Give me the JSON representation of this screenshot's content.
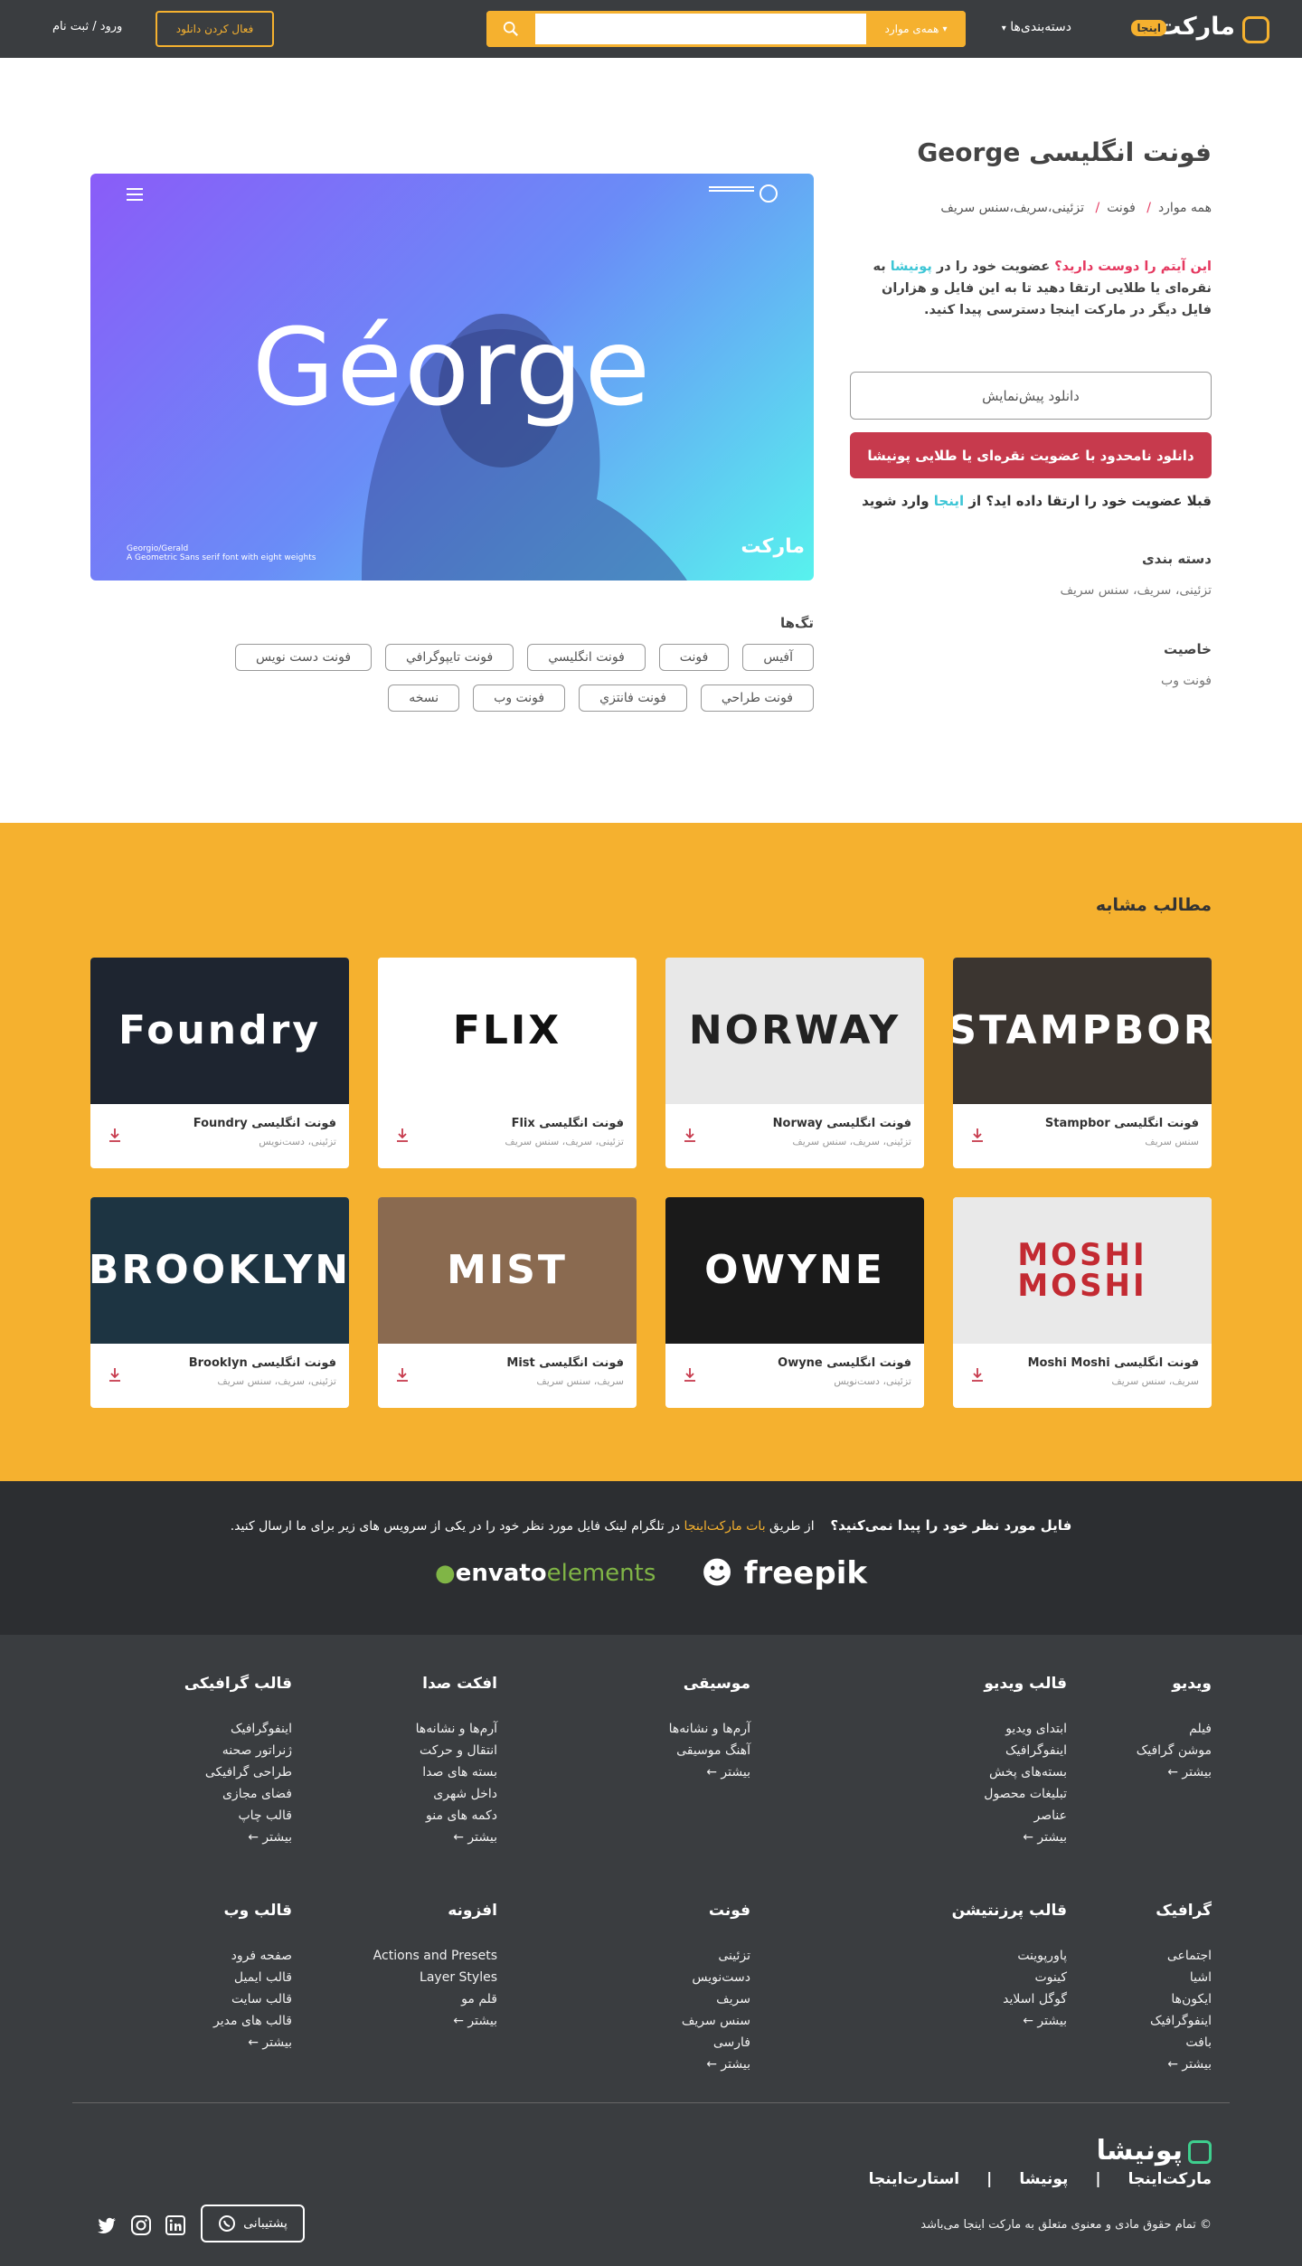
{
  "header": {
    "logo_text": "مارکت",
    "logo_badge": "اینجا",
    "categories_label": "دسته‌بندی‌ها",
    "search_scope": "همه‌ی موارد",
    "search_placeholder": "",
    "activate_download": "فعال کردن دانلود",
    "login": "ورود / ثبت نام"
  },
  "product": {
    "title": "فونت انگلیسی George",
    "breadcrumb": [
      "همه موارد",
      "فونت",
      "تزئینی،سریف،سنس سریف"
    ],
    "promo_pink": "این آیتم را دوست دارید؟",
    "promo_1": " عضویت خود را در ",
    "promo_link": "پونیشا",
    "promo_2": " به نقره‌ای یا طلایی ارتقا دهید تا به این فایل و هزاران فایل دیگر در مارکت اینجا دسترسی پیدا کنید.",
    "preview_button": "دانلود پیش‌نمایش",
    "premium_button": "دانلود نامحدود با عضویت نقره‌ای یا طلایی پونیشا",
    "already_1": "قبلا عضویت خود را ارتقا داده اید؟ از ",
    "already_link": "اینجا",
    "already_2": " وارد شوید",
    "category_label": "دسته بندی",
    "category_value": "تزئینی، سریف، سنس سریف",
    "feature_label": "خاصیت",
    "feature_value": "فونت وب",
    "hero_title": "Géorge",
    "hero_sub": "Georgio/Gerald\nA Geometric Sans serif font with eight weights",
    "tags_title": "تگ‌ها",
    "tags": [
      "آفیس",
      "فونت",
      "فونت انگلیسي",
      "فونت تایپوگرافي",
      "فونت دست نویس",
      "فونت طراحي",
      "فونت فانتزي",
      "فونت وب",
      "نسخه"
    ]
  },
  "related": {
    "title": "مطالب مشابه",
    "cards": [
      {
        "title": "فونت انگلیسی Stampbor",
        "sub": "سنس سریف",
        "img": "STAMPBOR",
        "bg": "#3b3530",
        "fg": "#ffffff"
      },
      {
        "title": "فونت انگلیسی Norway",
        "sub": "تزئینی، سریف، سنس سریف",
        "img": "NORWAY",
        "bg": "#e8e8e8",
        "fg": "#222222"
      },
      {
        "title": "فونت انگلیسی Flix",
        "sub": "تزئینی، سریف، سنس سریف",
        "img": "FLIX",
        "bg": "#ffffff",
        "fg": "#111111"
      },
      {
        "title": "فونت انگلیسی Foundry",
        "sub": "تزئینی، دست‌نویس",
        "img": "Foundry",
        "bg": "#1e2530",
        "fg": "#ffffff"
      },
      {
        "title": "فونت انگلیسی Moshi Moshi",
        "sub": "سریف، سنس سریف",
        "img": "MOSHI MOSHI",
        "bg": "#e9e9e9",
        "fg": "#c32a32"
      },
      {
        "title": "فونت انگلیسی Owyne",
        "sub": "تزئینی، دست‌نویس",
        "img": "OWYNE",
        "bg": "#1a1a1a",
        "fg": "#ffffff"
      },
      {
        "title": "فونت انگلیسی Mist",
        "sub": "سریف، سنس سریف",
        "img": "MIST",
        "bg": "#8a6a50",
        "fg": "#ffffff"
      },
      {
        "title": "فونت انگلیسی Brooklyn",
        "sub": "تزئینی، سریف، سنس سریف",
        "img": "BROOKLYN",
        "bg": "#1d3442",
        "fg": "#ffffff"
      }
    ]
  },
  "freepik": {
    "question": "فایل مورد نظر خود را پیدا نمی‌کنید؟",
    "text_1": "از طریق ",
    "bot": "بات مارکت‌اینجا",
    "text_2": " در تلگرام لینک فایل مورد نظر خود را در یکی از سرویس های زیر برای ما ارسال کنید.",
    "envato_1": "envato",
    "envato_2": "elements",
    "freepik": "freepik"
  },
  "footer": {
    "cols": [
      {
        "title": "ویدیو",
        "items": [
          "فیلم",
          "موشن گرافیک",
          "بیشتر ←"
        ]
      },
      {
        "title": "قالب ویدیو",
        "items": [
          "ابتدای ویدیو",
          "اینفوگرافیک",
          "بسته‌های پخش",
          "تبلیغات محصول",
          "عناصر",
          "بیشتر ←"
        ]
      },
      {
        "title": "موسیقی",
        "items": [
          "آرم‌ها و نشانه‌ها",
          "آهنگ موسیقی",
          "بیشتر ←"
        ]
      },
      {
        "title": "افکت صدا",
        "items": [
          "آرم‌ها و نشانه‌ها",
          "انتقال و حرکت",
          "بسته های صدا",
          "داخل شهری",
          "دکمه های منو",
          "بیشتر ←"
        ]
      },
      {
        "title": "قالب گرافیکی",
        "items": [
          "اینفوگرافیک",
          "ژنراتور صحنه",
          "طراحی گرافیکی",
          "فضای مجازی",
          "قالب چاپ",
          "بیشتر ←"
        ]
      },
      {
        "title": "گرافیک",
        "items": [
          "اجتماعی",
          "اشیا",
          "ایکون‌ها",
          "اینفوگرافیک",
          "بافت",
          "بیشتر ←"
        ]
      },
      {
        "title": "قالب پرزنتیشن",
        "items": [
          "پاورپوینت",
          "کینوت",
          "گوگل اسلاید",
          "بیشتر ←"
        ]
      },
      {
        "title": "فونت",
        "items": [
          "تزئینی",
          "دست‌نویس",
          "سریف",
          "سنس سریف",
          "فارسی",
          "بیشتر ←"
        ]
      },
      {
        "title": "افزونه",
        "items": [
          "Actions and Presets",
          "Layer Styles",
          "قلم مو",
          "بیشتر ←"
        ]
      },
      {
        "title": "قالب وب",
        "items": [
          "صفحه فرود",
          "قالب ایمیل",
          "قالب سایت",
          "قالب های مدیر",
          "بیشتر ←"
        ]
      }
    ],
    "brand": "پونیشا",
    "links": [
      "مارکت‌اینجا",
      "|",
      "پونیشا",
      "|",
      "استارت‌اینجا"
    ],
    "copyright": "© تمام حقوق مادی و معنوی متعلق به مارکت اینجا می‌باشد",
    "support": "پشتیبانی",
    "social_icons": [
      "linkedin-icon",
      "instagram-icon",
      "twitter-icon"
    ]
  }
}
